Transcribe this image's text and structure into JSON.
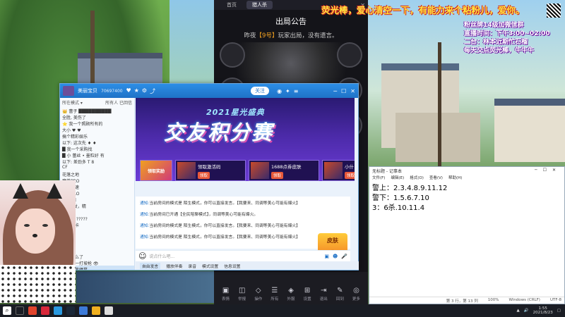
{
  "banner": {
    "headline": "荧光棒，爱心清空一下，有能力来个粘粉儿，爱你。",
    "line1": "粉丝牌14级加微信群",
    "line2": "直播时间：下午3:00~02:00",
    "line3": "二台：林本近期忙石榴",
    "line4": "每天交点荧光棒，牛牛牛"
  },
  "phone": {
    "tab_home": "首页",
    "tab_room": "猎人杀",
    "title": "出局公告",
    "notice_prefix": "昨夜",
    "notice_highlight": "【9号】",
    "notice_suffix": "玩家出局，没有遗言。",
    "bottom_buttons": [
      {
        "icon": "▣",
        "label": "表情"
      },
      {
        "icon": "◫",
        "label": "举报"
      },
      {
        "icon": "◇",
        "label": "操作"
      },
      {
        "icon": "☰",
        "label": "所有"
      },
      {
        "icon": "◈",
        "label": "外服"
      },
      {
        "icon": "⊞",
        "label": "设置"
      },
      {
        "icon": "⇥",
        "label": "退出"
      },
      {
        "icon": "✎",
        "label": "回到"
      },
      {
        "icon": "◎",
        "label": "更多"
      }
    ]
  },
  "qq": {
    "window_name": "美丽宝贝",
    "window_id": "70697400",
    "follow_button": "关注",
    "sidebar_header_left": "所在模式 ▾",
    "sidebar_header_right": "所有人 已回信",
    "sidebar_items": [
      "👑 蕾子 ██████████",
      "全胜, 美伤了",
      "⭐ 我一个照顾所有的",
      "大小 ♥ ♥",
      "搞个精彩娱乐",
      "以下: 这次先 ♦ ♦",
      "█ 我一个采购找",
      "█ 小 蕾丝 • 墨粒好 有",
      "以下: 差劲多 T 8",
      "CF",
      "花落之地",
      "魔兽PRO",
      "争夺加速",
      "稚水PRO",
      "出 美丽",
      "我 出 发，精",
      "卡尔 5",
      "卡卡罗 ?????",
      "卡卡罗卡",
      "黑铁",
      "魅心绿",
      "█ ██",
      "汉堡",
      "自己怎么了",
      "小朋友一打坡枪 👁",
      "吃鸡风变绩墓",
      "学无止境",
      "胖胖胖胖",
      "LF 9 ♦ ♦",
      "卡卡不夫了"
    ],
    "promo_subtitle": "2021星光盛典",
    "promo_title": "交友积分赛",
    "promo_cards": [
      {
        "title": "领取奖励",
        "btn": ""
      },
      {
        "title": "领取激活码",
        "btn": "领取"
      },
      {
        "title": "1688点券皮肤",
        "btn": "领取"
      },
      {
        "title": "小什",
        "btn": "领取"
      }
    ],
    "chat_rows": [
      {
        "tag": "通知:",
        "text": "当前房间的模式是 陌生模式，你可以直接发言。【我要来、同调等美心可能有爆火】"
      },
      {
        "tag": "通知:",
        "text": "当前房间已开通【全民陪聊模式】，同调等美心可能有爆火。"
      },
      {
        "tag": "通知:",
        "text": "当前房间的模式是 陌生模式，你可以直接发言。【我要来、同调等美心可能有爆火】"
      },
      {
        "tag": "通知:",
        "text": "当前房间的模式是 陌生模式，你可以直接发言。【我要来、同调等美心可能有爆火】"
      }
    ],
    "badge_line1": "皮肤",
    "badge_line2": "免费领",
    "input_placeholder": "说点什么吧...",
    "bottom_items": [
      "自由发言",
      "播放伴奏",
      "录音",
      "模式设置",
      "信息设置"
    ]
  },
  "notepad": {
    "title": "无标题 - 记事本",
    "menu": [
      "文件(F)",
      "编辑(E)",
      "格式(O)",
      "查看(V)",
      "帮助(H)"
    ],
    "lines": [
      "警上：2.3.4.8.9.11.12",
      "警下：1.5.6.7.10",
      "3：6杀.10.11.4"
    ],
    "status": [
      "第 3 行，第 13 列",
      "100%",
      "Windows (CRLF)",
      "UTF-8"
    ]
  },
  "taskbar": {
    "time": "1:55",
    "date": "2021/8/23"
  },
  "colors": {
    "qq_blue": "#1f72c7",
    "banner_yellow": "#ffe640",
    "promo_purple": "#4b2aa8"
  }
}
